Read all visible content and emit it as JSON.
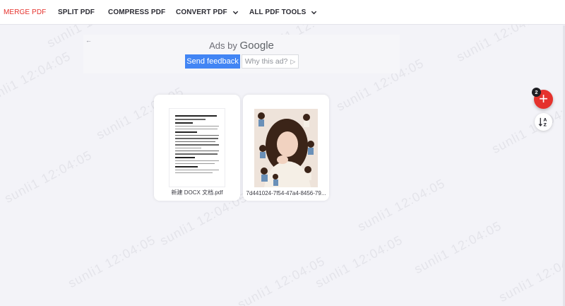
{
  "nav": {
    "items": [
      {
        "label": "MERGE PDF",
        "active": true
      },
      {
        "label": "SPLIT PDF"
      },
      {
        "label": "COMPRESS PDF"
      },
      {
        "label": "CONVERT PDF",
        "dropdown": true
      },
      {
        "label": "ALL PDF TOOLS",
        "dropdown": true
      }
    ]
  },
  "ad": {
    "ads_by": "Ads by",
    "google": "Google",
    "send_feedback": "Send feedback",
    "why_this_ad": "Why this ad?",
    "back_icon": "arrow-left-icon"
  },
  "files": [
    {
      "name": "新建 DOCX 文档.pdf",
      "thumb": "document"
    },
    {
      "name": "7d441024-7f54-47a4-8456-79...",
      "thumb": "photo"
    }
  ],
  "fab": {
    "count": "2",
    "add_icon": "plus-icon",
    "sort_icon": "sort-az-icon"
  },
  "watermark": "sunli1 12:04:05",
  "colors": {
    "accent": "#e5322d",
    "feedback_blue": "#4285f4",
    "background": "#f3f3f8"
  }
}
